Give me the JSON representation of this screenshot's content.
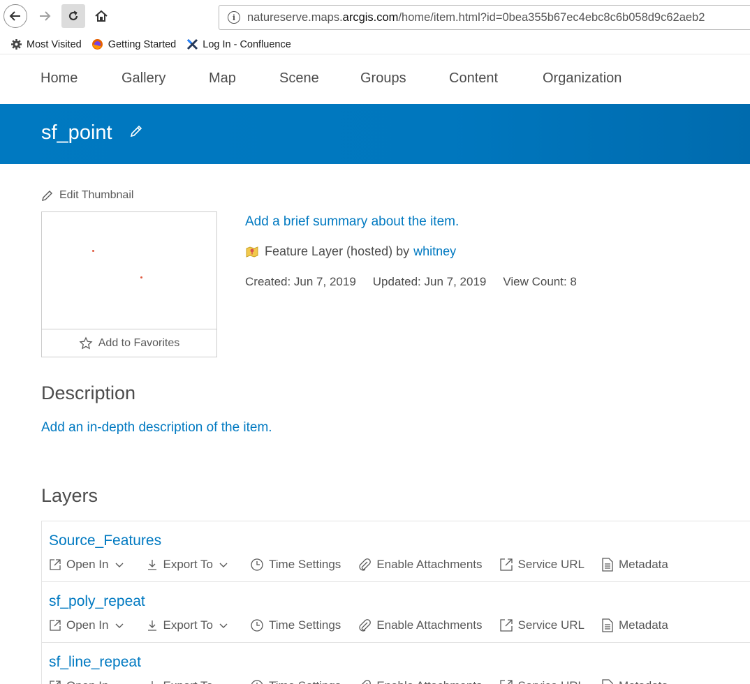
{
  "browser": {
    "url_prefix": "natureserve.maps.",
    "url_domain": "arcgis.com",
    "url_suffix": "/home/item.html?id=0bea355b67ec4ebc8c6b058d9c62aeb2",
    "bookmarks": [
      {
        "label": "Most Visited",
        "icon": "gear-icon"
      },
      {
        "label": "Getting Started",
        "icon": "firefox-icon"
      },
      {
        "label": "Log In - Confluence",
        "icon": "confluence-icon"
      }
    ]
  },
  "nav": {
    "items": [
      "Home",
      "Gallery",
      "Map",
      "Scene",
      "Groups",
      "Content",
      "Organization"
    ]
  },
  "item": {
    "title": "sf_point",
    "edit_thumbnail": "Edit Thumbnail",
    "add_favorites": "Add to Favorites",
    "summary_prompt": "Add a brief summary about the item.",
    "type_text": "Feature Layer (hosted) by",
    "owner": "whitney",
    "created": "Created: Jun 7, 2019",
    "updated": "Updated: Jun 7, 2019",
    "view_count": "View Count: 8"
  },
  "description": {
    "heading": "Description",
    "prompt": "Add an in-depth description of the item."
  },
  "layers": {
    "heading": "Layers",
    "actions": {
      "open_in": "Open In",
      "export_to": "Export To",
      "time_settings": "Time Settings",
      "enable_attachments": "Enable Attachments",
      "service_url": "Service URL",
      "metadata": "Metadata"
    },
    "items": [
      {
        "name": "Source_Features"
      },
      {
        "name": "sf_poly_repeat"
      },
      {
        "name": "sf_line_repeat"
      }
    ]
  },
  "colors": {
    "banner": "#0079c1",
    "link": "#0079c1",
    "text": "#4c4c4c"
  }
}
